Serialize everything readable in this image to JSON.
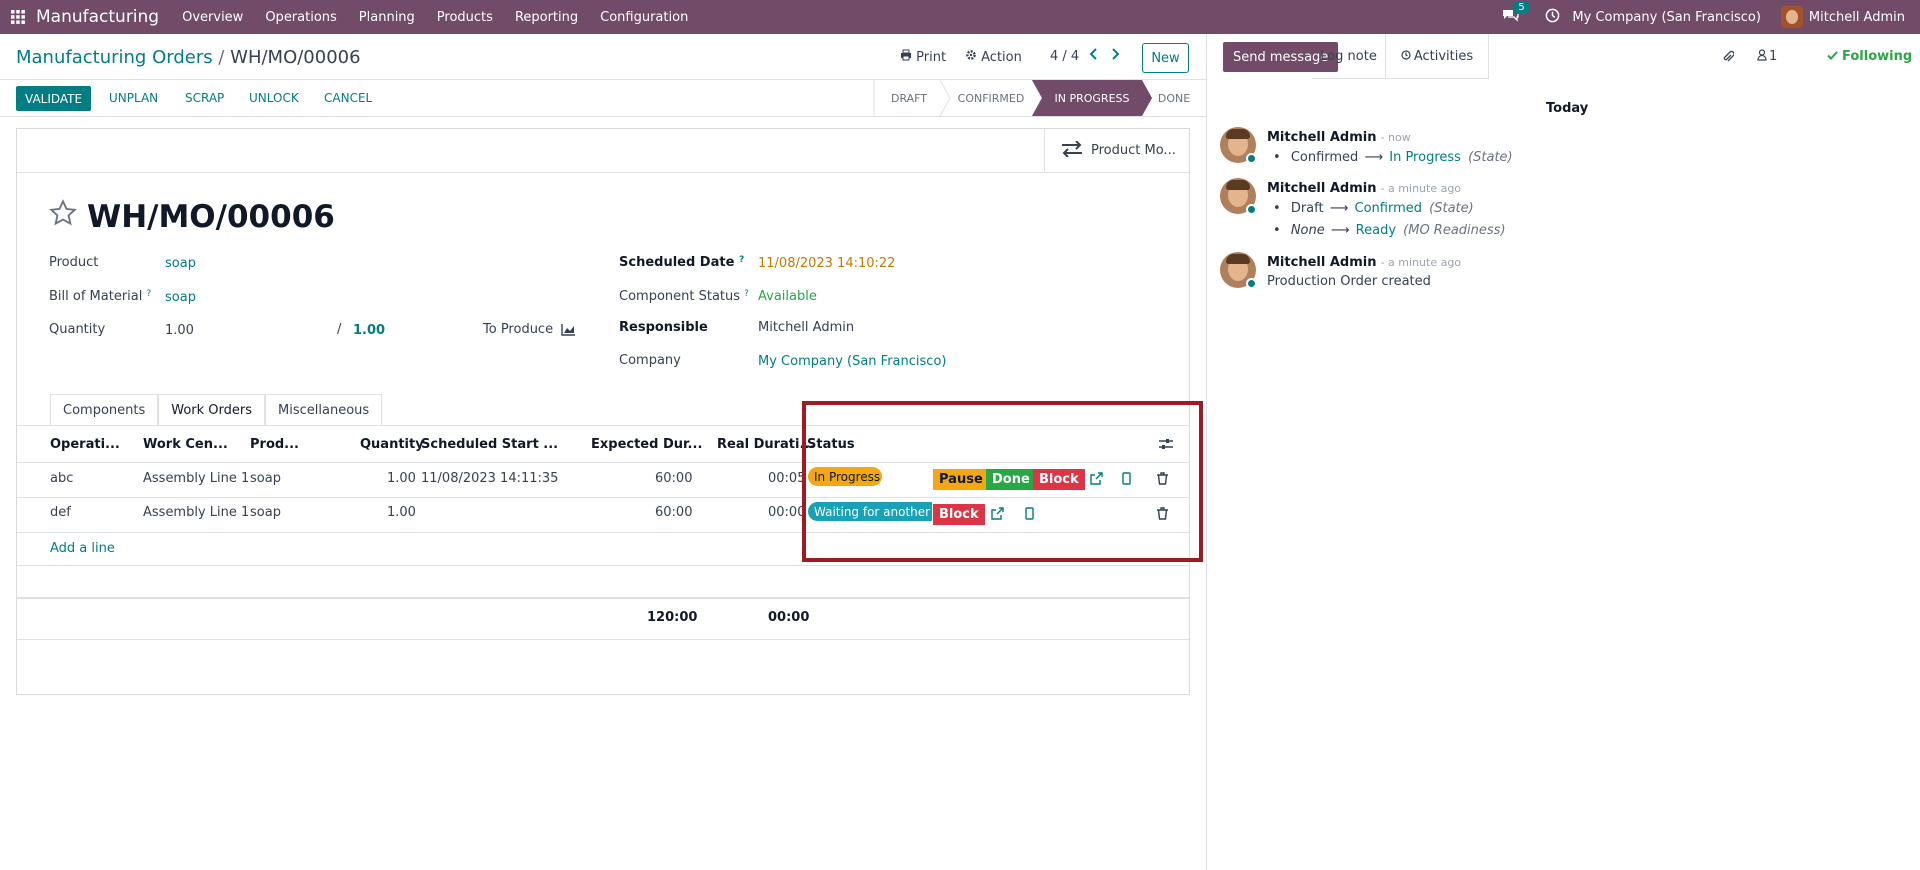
{
  "topbar": {
    "app_name": "Manufacturing",
    "menus": [
      "Overview",
      "Operations",
      "Planning",
      "Products",
      "Reporting",
      "Configuration"
    ],
    "messages_count": "5",
    "company": "My Company (San Francisco)",
    "user": "Mitchell Admin"
  },
  "breadcrumb": {
    "parent": "Manufacturing Orders",
    "separator": "/",
    "current": "WH/MO/00006"
  },
  "control": {
    "print": "Print",
    "action": "Action",
    "pager": "4 / 4",
    "new": "New"
  },
  "statusbar": {
    "buttons": [
      "VALIDATE",
      "UNPLAN",
      "SCRAP",
      "UNLOCK",
      "CANCEL"
    ],
    "stages": [
      "DRAFT",
      "CONFIRMED",
      "IN PROGRESS",
      "DONE"
    ],
    "active_stage": "IN PROGRESS"
  },
  "smart_button": "Product Mo...",
  "record": {
    "title": "WH/MO/00006",
    "product_label": "Product",
    "product": "soap",
    "bom_label": "Bill of Material",
    "bom": "soap",
    "qty_label": "Quantity",
    "qty": "1.00",
    "qty_sep": "/",
    "qty_total": "1.00",
    "to_produce_label": "To Produce",
    "sched_label": "Scheduled Date",
    "sched": "11/08/2023 14:10:22",
    "comp_status_label": "Component Status",
    "comp_status": "Available",
    "resp_label": "Responsible",
    "resp": "Mitchell Admin",
    "company_label": "Company",
    "company": "My Company (San Francisco)"
  },
  "tabs": [
    "Components",
    "Work Orders",
    "Miscellaneous"
  ],
  "table": {
    "headers": [
      "Operati...",
      "Work Cen...",
      "Prod...",
      "Quantity",
      "Scheduled Start ...",
      "Expected Dur...",
      "Real Durati...",
      "Status"
    ],
    "rows": [
      {
        "op": "abc",
        "wc": "Assembly Line 1",
        "prod": "soap",
        "qty": "1.00",
        "start": "11/08/2023 14:11:35",
        "exp": "60:00",
        "real": "00:05",
        "status": "In Progress",
        "actions": [
          "Pause",
          "Done",
          "Block"
        ]
      },
      {
        "op": "def",
        "wc": "Assembly Line 1",
        "prod": "soap",
        "qty": "1.00",
        "start": "",
        "exp": "60:00",
        "real": "00:00",
        "status": "Waiting for another WO",
        "actions": [
          "Block"
        ]
      }
    ],
    "add_line": "Add a line",
    "total_expected": "120:00",
    "total_real": "00:00"
  },
  "chatter": {
    "send_message": "Send message",
    "log_note": "Log note",
    "activities": "Activities",
    "followers_count": "1",
    "following": "Following",
    "today": "Today",
    "messages": [
      {
        "author": "Mitchell Admin",
        "time": "- now",
        "lines": [
          {
            "from": "Confirmed",
            "to": "In Progress",
            "field": "(State)"
          }
        ]
      },
      {
        "author": "Mitchell Admin",
        "time": "- a minute ago",
        "lines": [
          {
            "from": "Draft",
            "to": "Confirmed",
            "field": "(State)"
          },
          {
            "from": "None",
            "to": "Ready",
            "field": "(MO Readiness)"
          }
        ]
      },
      {
        "author": "Mitchell Admin",
        "time": "- a minute ago",
        "text": "Production Order created"
      }
    ]
  },
  "colors": {
    "brand": "#714b67",
    "accent": "#017e84",
    "warning": "#f3a712",
    "success": "#28a745",
    "danger": "#dc3545",
    "info": "#17a2b8",
    "highlight": "#a01a24"
  }
}
